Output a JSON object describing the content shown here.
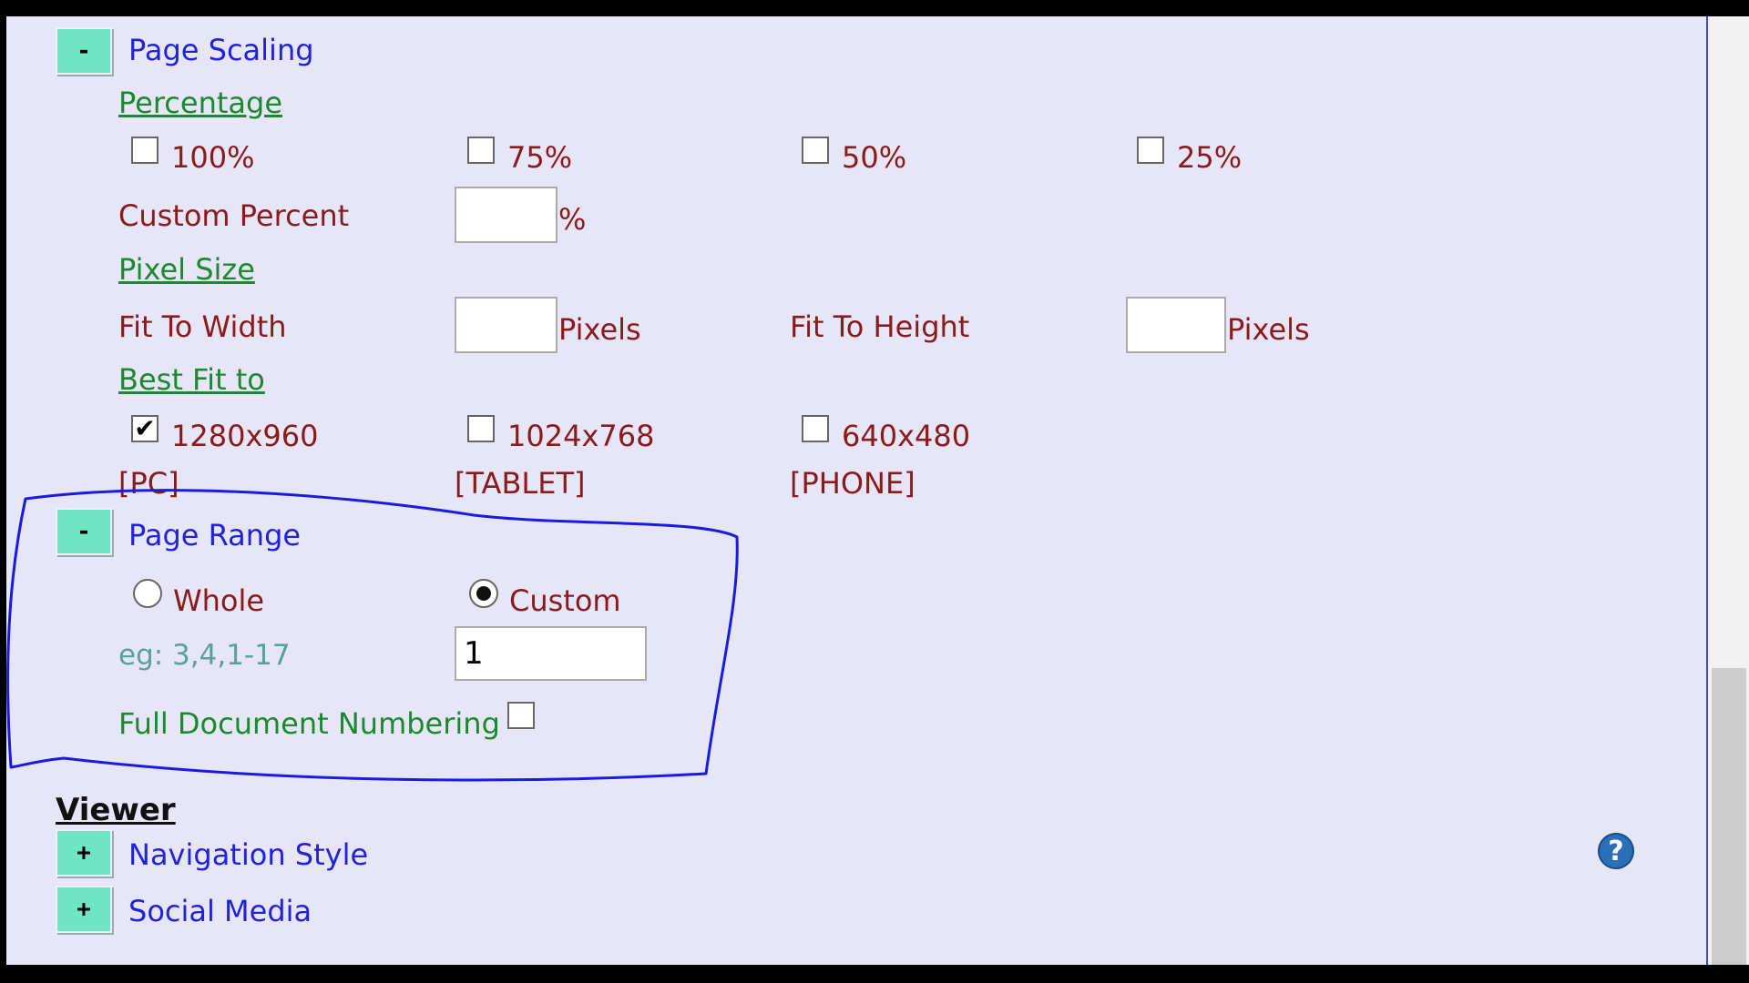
{
  "page_scaling": {
    "toggle": "-",
    "title": "Page Scaling",
    "percentage": {
      "heading": "Percentage",
      "options": [
        {
          "label": "100%",
          "checked": false
        },
        {
          "label": "75%",
          "checked": false
        },
        {
          "label": "50%",
          "checked": false
        },
        {
          "label": "25%",
          "checked": false
        }
      ],
      "custom_label": "Custom Percent",
      "custom_value": "",
      "custom_unit": "%"
    },
    "pixel_size": {
      "heading": "Pixel Size",
      "width_label": "Fit To Width",
      "width_value": "",
      "width_unit": "Pixels",
      "height_label": "Fit To Height",
      "height_value": "",
      "height_unit": "Pixels"
    },
    "best_fit": {
      "heading": "Best Fit to",
      "options": [
        {
          "label": "1280x960",
          "device": "[PC]",
          "checked": true
        },
        {
          "label": "1024x768",
          "device": "[TABLET]",
          "checked": false
        },
        {
          "label": "640x480",
          "device": "[PHONE]",
          "checked": false
        }
      ]
    }
  },
  "page_range": {
    "toggle": "-",
    "title": "Page Range",
    "options": [
      {
        "label": "Whole",
        "selected": false
      },
      {
        "label": "Custom",
        "selected": true
      }
    ],
    "example": "eg: 3,4,1-17",
    "value": "1",
    "full_numbering_label": "Full Document Numbering",
    "full_numbering_checked": false
  },
  "viewer": {
    "heading": "Viewer",
    "items": [
      {
        "toggle": "+",
        "title": "Navigation Style"
      },
      {
        "toggle": "+",
        "title": "Social Media"
      }
    ]
  },
  "icons": {
    "check": "checkmark-icon",
    "help": "help-icon",
    "help_glyph": "?"
  },
  "colors": {
    "annotation": "#1a1ae0",
    "toggle_bg": "#6ee6c4",
    "panel_bg": "#e6e6f8"
  }
}
